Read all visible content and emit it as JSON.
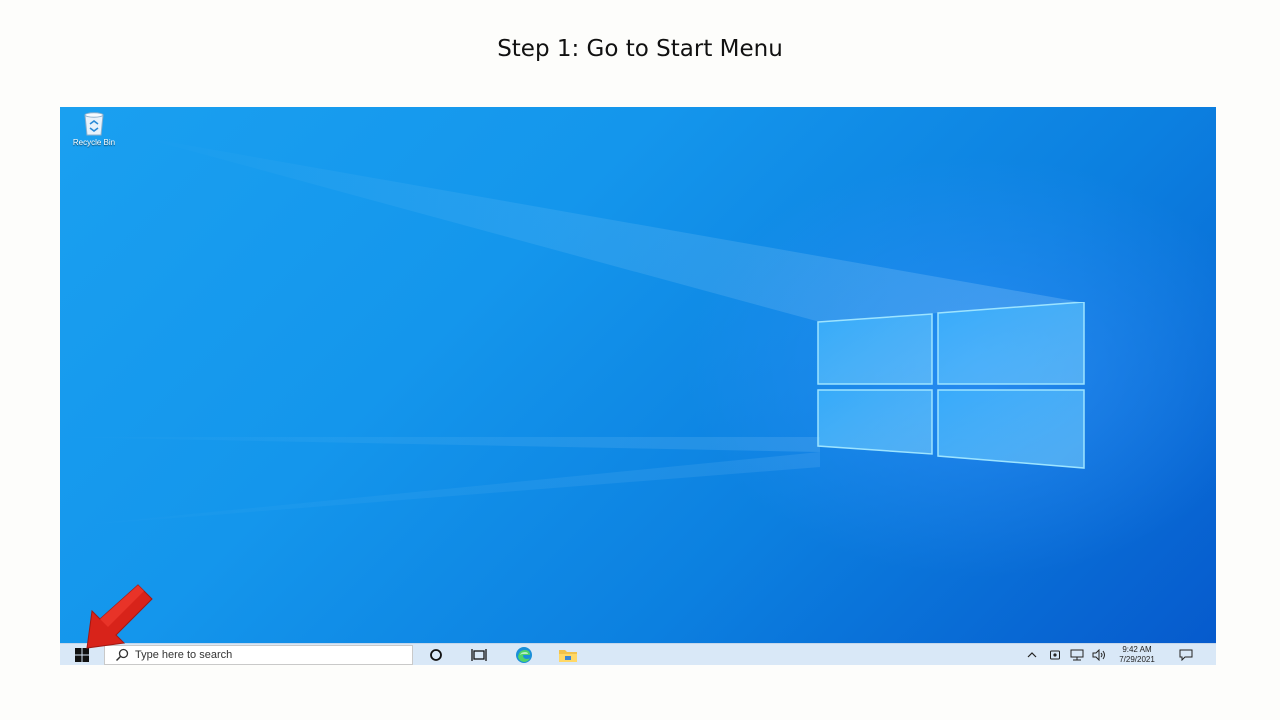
{
  "slide": {
    "title": "Step 1: Go to Start Menu"
  },
  "desktop": {
    "icons": [
      {
        "label": "Recycle Bin",
        "icon": "recycle-bin-icon"
      }
    ]
  },
  "taskbar": {
    "start_icon": "windows-start-icon",
    "search": {
      "placeholder": "Type here to search",
      "icon": "search-icon"
    },
    "pinned": [
      {
        "name": "Cortana",
        "icon": "cortana-icon"
      },
      {
        "name": "Task View",
        "icon": "task-view-icon"
      },
      {
        "name": "Microsoft Edge",
        "icon": "edge-icon"
      },
      {
        "name": "File Explorer",
        "icon": "file-explorer-icon"
      }
    ],
    "tray": {
      "icons": [
        "chevron-up-icon",
        "meet-now-icon",
        "network-icon",
        "volume-icon",
        "notification-icon"
      ],
      "time": "9:42 AM",
      "date": "7/29/2021"
    }
  },
  "annotation": {
    "arrow_color": "#d8231a",
    "points_to": "start-button"
  },
  "colors": {
    "taskbar": "#d9e8f7",
    "desktop_accent": "#1496ec",
    "arrow": "#d8231a"
  }
}
